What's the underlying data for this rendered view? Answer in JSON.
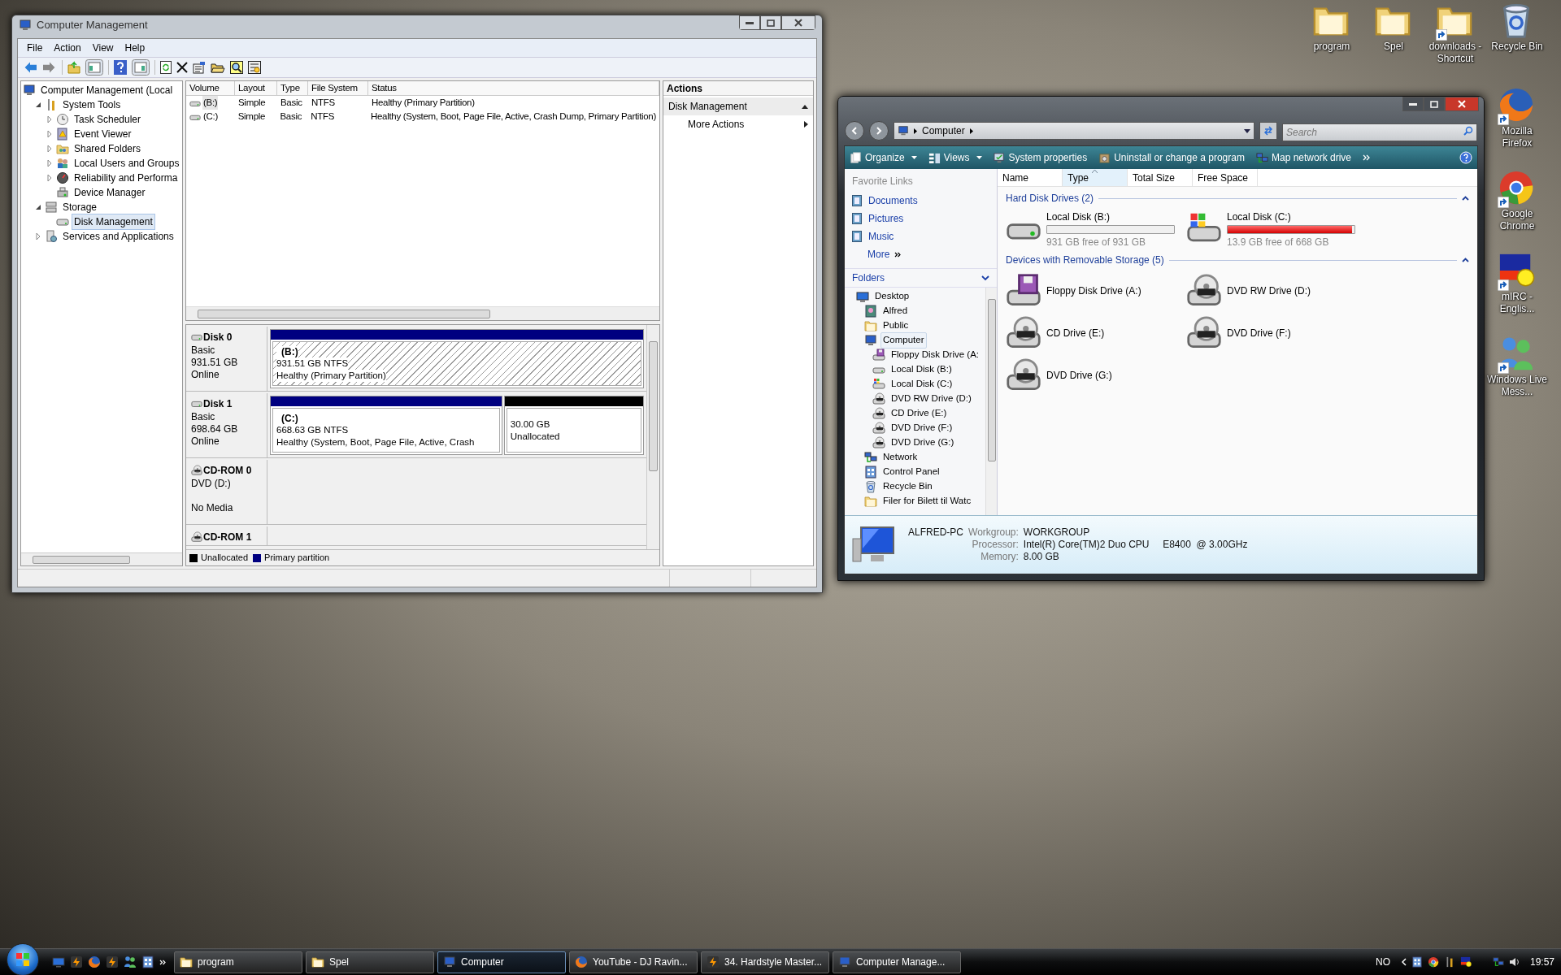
{
  "desktop_icons": [
    {
      "label": "program",
      "kind": "folder",
      "shortcut": false
    },
    {
      "label": "Spel",
      "kind": "folder",
      "shortcut": false
    },
    {
      "label": "downloads - Shortcut",
      "kind": "folder",
      "shortcut": true
    },
    {
      "label": "Recycle Bin",
      "kind": "recycle",
      "shortcut": false
    },
    {
      "label": "Mozilla Firefox",
      "kind": "firefox",
      "shortcut": true
    },
    {
      "label": "Google Chrome",
      "kind": "chrome",
      "shortcut": true
    },
    {
      "label": "mIRC - Englis...",
      "kind": "mirc",
      "shortcut": true
    },
    {
      "label": "Windows Live Mess...",
      "kind": "messenger",
      "shortcut": true
    }
  ],
  "computer_management": {
    "title": "Computer Management",
    "menu": [
      "File",
      "Action",
      "View",
      "Help"
    ],
    "tree": [
      {
        "label": "Computer Management (Local",
        "kind": "computer",
        "selected": false,
        "children": [
          {
            "label": "System Tools",
            "kind": "tools",
            "expanded": true,
            "selected": false,
            "children": [
              {
                "label": "Task Scheduler",
                "kind": "clock",
                "expanded": false,
                "selected": false
              },
              {
                "label": "Event Viewer",
                "kind": "log",
                "expanded": false,
                "selected": false
              },
              {
                "label": "Shared Folders",
                "kind": "shared",
                "expanded": false,
                "selected": false
              },
              {
                "label": "Local Users and Groups",
                "kind": "users",
                "expanded": false,
                "selected": false
              },
              {
                "label": "Reliability and Performa",
                "kind": "gauge",
                "expanded": false,
                "selected": false
              },
              {
                "label": "Device Manager",
                "kind": "device",
                "selected": false
              }
            ]
          },
          {
            "label": "Storage",
            "kind": "storage",
            "expanded": true,
            "selected": false,
            "children": [
              {
                "label": "Disk Management",
                "kind": "disk",
                "selected": true
              }
            ]
          },
          {
            "label": "Services and Applications",
            "kind": "services",
            "expanded": false,
            "selected": false
          }
        ]
      }
    ],
    "volume_table": {
      "columns": [
        "Volume",
        "Layout",
        "Type",
        "File System",
        "Status"
      ],
      "rows": [
        {
          "selected": true,
          "cells": [
            "(B:)",
            "Simple",
            "Basic",
            "NTFS",
            "Healthy (Primary Partition)"
          ]
        },
        {
          "selected": false,
          "cells": [
            "(C:)",
            "Simple",
            "Basic",
            "NTFS",
            "Healthy (System, Boot, Page File, Active, Crash Dump, Primary Partition)"
          ]
        }
      ]
    },
    "disks": [
      {
        "name": "Disk 0",
        "kind": "disk",
        "lines": [
          "Basic",
          "931.51 GB",
          "Online"
        ],
        "partitions": [
          {
            "kind": "primary",
            "selected": true,
            "label": "(B:)",
            "lines": [
              "931.51 GB NTFS",
              "Healthy (Primary Partition)"
            ]
          }
        ]
      },
      {
        "name": "Disk 1",
        "kind": "disk",
        "lines": [
          "Basic",
          "698.64 GB",
          "Online"
        ],
        "partitions": [
          {
            "kind": "primary",
            "selected": false,
            "label": "(C:)",
            "lines": [
              "668.63 GB NTFS",
              "Healthy (System, Boot, Page File, Active, Crash"
            ]
          },
          {
            "kind": "unallocated",
            "selected": false,
            "lines": [
              "30.00 GB",
              "Unallocated"
            ]
          }
        ]
      },
      {
        "name": "CD-ROM 0",
        "kind": "cdrom",
        "lines": [
          "DVD (D:)",
          "No Media"
        ]
      },
      {
        "name": "CD-ROM 1",
        "kind": "cut"
      }
    ],
    "legend": [
      {
        "label": "Unallocated",
        "color": "#000000"
      },
      {
        "label": "Primary partition",
        "color": "#000080"
      }
    ],
    "actions": {
      "header": "Actions",
      "section": {
        "label": "Disk Management",
        "expanded": true
      },
      "items": [
        "More Actions"
      ]
    }
  },
  "explorer": {
    "address": [
      "Computer"
    ],
    "search": {
      "placeholder": "Search"
    },
    "toolbar": [
      {
        "label": "Organize",
        "kind": "menu"
      },
      {
        "label": "Views",
        "kind": "menu"
      },
      {
        "label": "System properties",
        "kind": "properties"
      },
      {
        "label": "Uninstall or change a program",
        "kind": "programs"
      },
      {
        "label": "Map network drive",
        "kind": "network"
      }
    ],
    "favorite_links": {
      "title": "Favorite Links",
      "items": [
        "Documents",
        "Pictures",
        "Music"
      ],
      "more": "More"
    },
    "folders": {
      "title": "Folders",
      "expanded": true,
      "tree": [
        {
          "label": "Desktop",
          "kind": "desktop",
          "selected": false,
          "children": [
            {
              "label": "Alfred",
              "kind": "user",
              "selected": false
            },
            {
              "label": "Public",
              "kind": "folder",
              "selected": false
            },
            {
              "label": "Computer",
              "kind": "computer",
              "selected": true,
              "children": [
                {
                  "label": "Floppy Disk Drive (A:",
                  "kind": "floppy",
                  "selected": false
                },
                {
                  "label": "Local Disk (B:)",
                  "kind": "drive",
                  "selected": false
                },
                {
                  "label": "Local Disk (C:)",
                  "kind": "windrive",
                  "selected": false
                },
                {
                  "label": "DVD RW Drive (D:)",
                  "kind": "disc",
                  "selected": false
                },
                {
                  "label": "CD Drive (E:)",
                  "kind": "disc",
                  "selected": false
                },
                {
                  "label": "DVD Drive (F:)",
                  "kind": "disc",
                  "selected": false
                },
                {
                  "label": "DVD Drive (G:)",
                  "kind": "disc",
                  "selected": false
                }
              ]
            },
            {
              "label": "Network",
              "kind": "network",
              "selected": false
            },
            {
              "label": "Control Panel",
              "kind": "panel",
              "selected": false
            },
            {
              "label": "Recycle Bin",
              "kind": "recycle",
              "selected": false
            },
            {
              "label": "Filer for Bilett til Watc",
              "kind": "folder",
              "selected": false
            }
          ]
        }
      ]
    },
    "columns": [
      {
        "label": "Name",
        "sorted": false
      },
      {
        "label": "Type",
        "sorted": true
      },
      {
        "label": "Total Size",
        "sorted": false
      },
      {
        "label": "Free Space",
        "sorted": false
      }
    ],
    "groups": [
      {
        "title": "Hard Disk Drives (2)",
        "expanded": true,
        "items": [
          {
            "label": "Local Disk (B:)",
            "kind": "drive",
            "level": 0.0,
            "free": "931 GB free of 931 GB"
          },
          {
            "label": "Local Disk (C:)",
            "kind": "windrive",
            "level": 0.98,
            "free": "13.9 GB free of 668 GB"
          }
        ]
      },
      {
        "title": "Devices with Removable Storage (5)",
        "expanded": true,
        "items": [
          {
            "label": "Floppy Disk Drive (A:)",
            "kind": "floppy"
          },
          {
            "label": "DVD RW Drive (D:)",
            "kind": "disc"
          },
          {
            "label": "CD Drive (E:)",
            "kind": "disc"
          },
          {
            "label": "DVD Drive (F:)",
            "kind": "disc"
          },
          {
            "label": "DVD Drive (G:)",
            "kind": "disc"
          }
        ]
      }
    ],
    "details": {
      "name": "ALFRED-PC",
      "fields": [
        {
          "label": "Workgroup:",
          "value": "WORKGROUP"
        },
        {
          "label": "Processor:",
          "value": "Intel(R) Core(TM)2 Duo CPU     E8400  @ 3.00GHz"
        },
        {
          "label": "Memory:",
          "value": "8.00 GB"
        }
      ]
    }
  },
  "taskbar": {
    "buttons": [
      {
        "label": "program",
        "kind": "folder",
        "selected": false
      },
      {
        "label": "Spel",
        "kind": "folder",
        "selected": false
      },
      {
        "label": "Computer",
        "kind": "computer",
        "selected": true
      },
      {
        "label": "YouTube - DJ Ravin...",
        "kind": "firefox",
        "selected": false
      },
      {
        "label": "34. Hardstyle Master...",
        "kind": "winamp",
        "selected": false
      },
      {
        "label": "Computer Manage...",
        "kind": "computer",
        "selected": false
      }
    ],
    "language": "NO",
    "time": "19:57"
  }
}
